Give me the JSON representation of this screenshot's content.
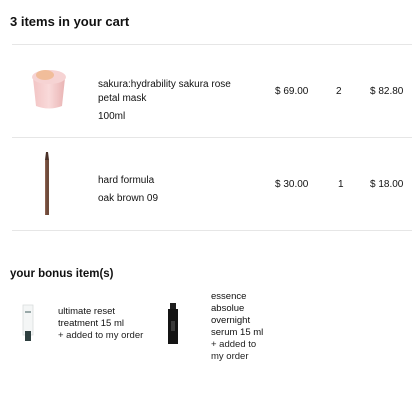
{
  "cart": {
    "title": "3 items in your cart"
  },
  "items": [
    {
      "name": "sakura:hydrability sakura rose petal mask",
      "size": "100ml",
      "price": "$ 69.00",
      "qty": "2",
      "total": "$ 82.80",
      "thumb": "pink-jar"
    },
    {
      "name": "hard formula",
      "size": "oak brown 09",
      "price": "$ 30.00",
      "qty": "1",
      "total": "$ 18.00",
      "thumb": "brow-pencil"
    }
  ],
  "bonus": {
    "title": "your bonus item(s)",
    "items": [
      {
        "name": "ultimate reset treatment 15 ml",
        "status": "+ added to my order",
        "thumb": "white-tube"
      },
      {
        "name": "essence absolue overnight serum 15 ml",
        "status": "+ added to my order",
        "thumb": "black-tube"
      }
    ]
  }
}
